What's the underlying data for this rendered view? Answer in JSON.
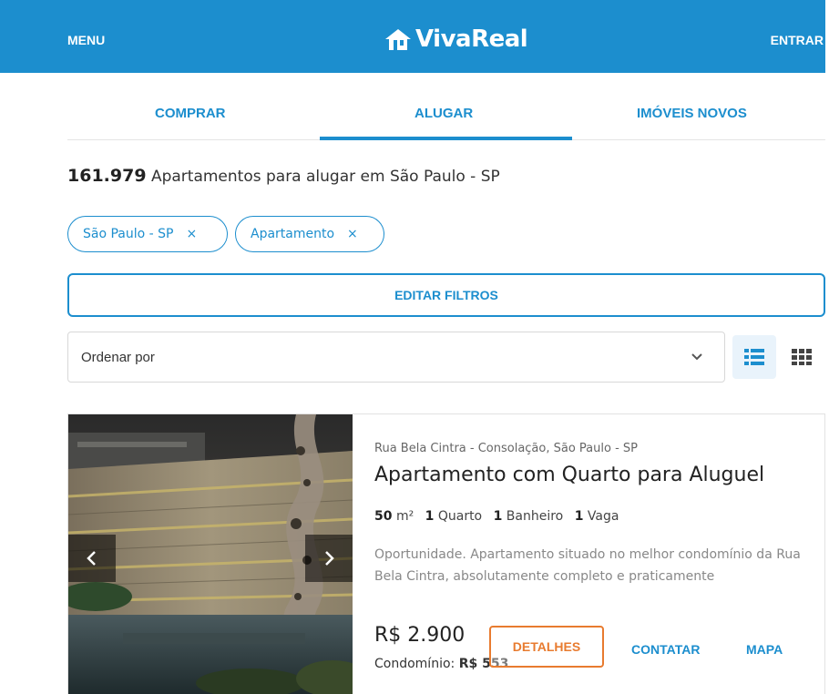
{
  "header": {
    "menu_label": "MENU",
    "brand": "VivaReal",
    "login_label": "ENTRAR",
    "brand_color": "#1c8ece"
  },
  "tabs": [
    {
      "label": "COMPRAR"
    },
    {
      "label": "ALUGAR",
      "active": true
    },
    {
      "label": "IMÓVEIS NOVOS"
    }
  ],
  "results": {
    "count": "161.979",
    "description": "Apartamentos para alugar em São Paulo - SP"
  },
  "filters": {
    "chips": [
      {
        "label": "São Paulo - SP",
        "remove": "×"
      },
      {
        "label": "Apartamento",
        "remove": "×"
      }
    ],
    "edit_label": "EDITAR FILTROS"
  },
  "sort": {
    "label": "Ordenar por",
    "icon": "chevron-down-icon"
  },
  "view_toggle": {
    "list_icon": "list-view-icon",
    "grid_icon": "grid-view-icon",
    "active": "list"
  },
  "listing": {
    "address": "Rua Bela Cintra - Consolação, São Paulo - SP",
    "title": "Apartamento com Quarto para Aluguel",
    "area_value": "50",
    "area_unit": "m²",
    "bedrooms_value": "1",
    "bedrooms_label": "Quarto",
    "bathrooms_value": "1",
    "bathrooms_label": "Banheiro",
    "parking_value": "1",
    "parking_label": "Vaga",
    "description": "Oportunidade. Apartamento situado no melhor condomínio da Rua Bela Cintra, absolutamente completo e praticamente",
    "price": "R$ 2.900",
    "condo_label": "Condomínio:",
    "condo_value": "R$ 553",
    "details_label": "DETALHES",
    "contact_label": "CONTATAR",
    "map_label": "MAPA",
    "prev_icon": "chevron-left-icon",
    "next_icon": "chevron-right-icon",
    "accent_color": "#e87b2f"
  }
}
